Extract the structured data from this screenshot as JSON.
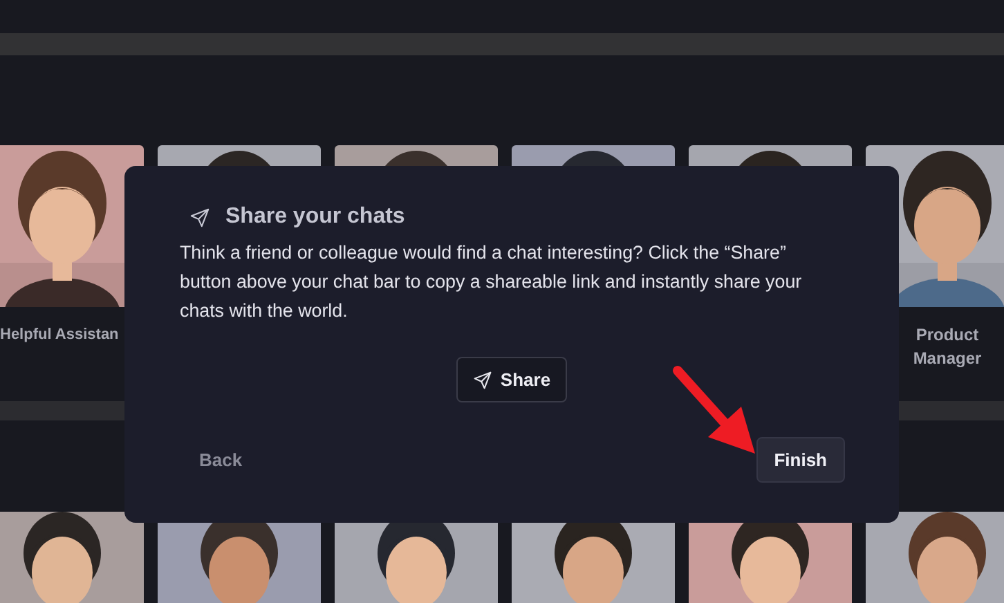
{
  "top_row_cards": [
    {
      "kind": "picture",
      "label": "Helpful Assistan"
    },
    {
      "kind": "picture"
    },
    {
      "kind": "picture"
    },
    {
      "kind": "picture"
    },
    {
      "kind": "picture"
    },
    {
      "kind": "picture",
      "label": "Product Manager"
    }
  ],
  "bottom_row_cards": [
    {
      "kind": "picture"
    },
    {
      "kind": "picture"
    },
    {
      "kind": "picture"
    },
    {
      "kind": "picture"
    },
    {
      "kind": "picture"
    },
    {
      "kind": "picture"
    }
  ],
  "dialog": {
    "title": "Share your chats",
    "body": "Think a friend or colleague would find a chat interesting? Click the “Share” button above your chat bar to copy a shareable link and instantly share your chats with the world.",
    "share_button": "Share",
    "back_button": "Back",
    "finish_button": "Finish"
  }
}
